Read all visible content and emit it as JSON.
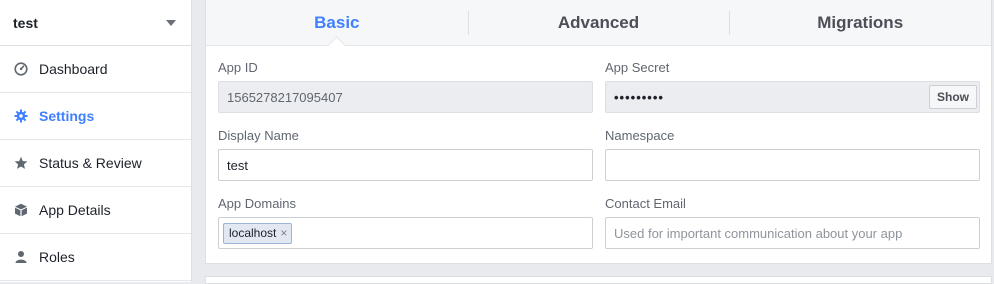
{
  "sidebar": {
    "app_name": "test",
    "items": [
      {
        "label": "Dashboard",
        "icon": "dashboard-icon"
      },
      {
        "label": "Settings",
        "icon": "gear-icon",
        "active": true
      },
      {
        "label": "Status & Review",
        "icon": "star-icon"
      },
      {
        "label": "App Details",
        "icon": "cube-icon"
      },
      {
        "label": "Roles",
        "icon": "person-icon"
      }
    ]
  },
  "tabs": [
    {
      "label": "Basic",
      "active": true
    },
    {
      "label": "Advanced"
    },
    {
      "label": "Migrations"
    }
  ],
  "form": {
    "app_id": {
      "label": "App ID",
      "value": "1565278217095407"
    },
    "app_secret": {
      "label": "App Secret",
      "value": "•••••••••",
      "show_label": "Show"
    },
    "display_name": {
      "label": "Display Name",
      "value": "test"
    },
    "namespace": {
      "label": "Namespace",
      "value": ""
    },
    "app_domains": {
      "label": "App Domains",
      "tokens": [
        "localhost"
      ],
      "remove_glyph": "×"
    },
    "contact_email": {
      "label": "Contact Email",
      "placeholder": "Used for important communication about your app"
    }
  },
  "colors": {
    "accent": "#4080ff",
    "background": "#e9eaed",
    "border": "#dddfe2"
  }
}
